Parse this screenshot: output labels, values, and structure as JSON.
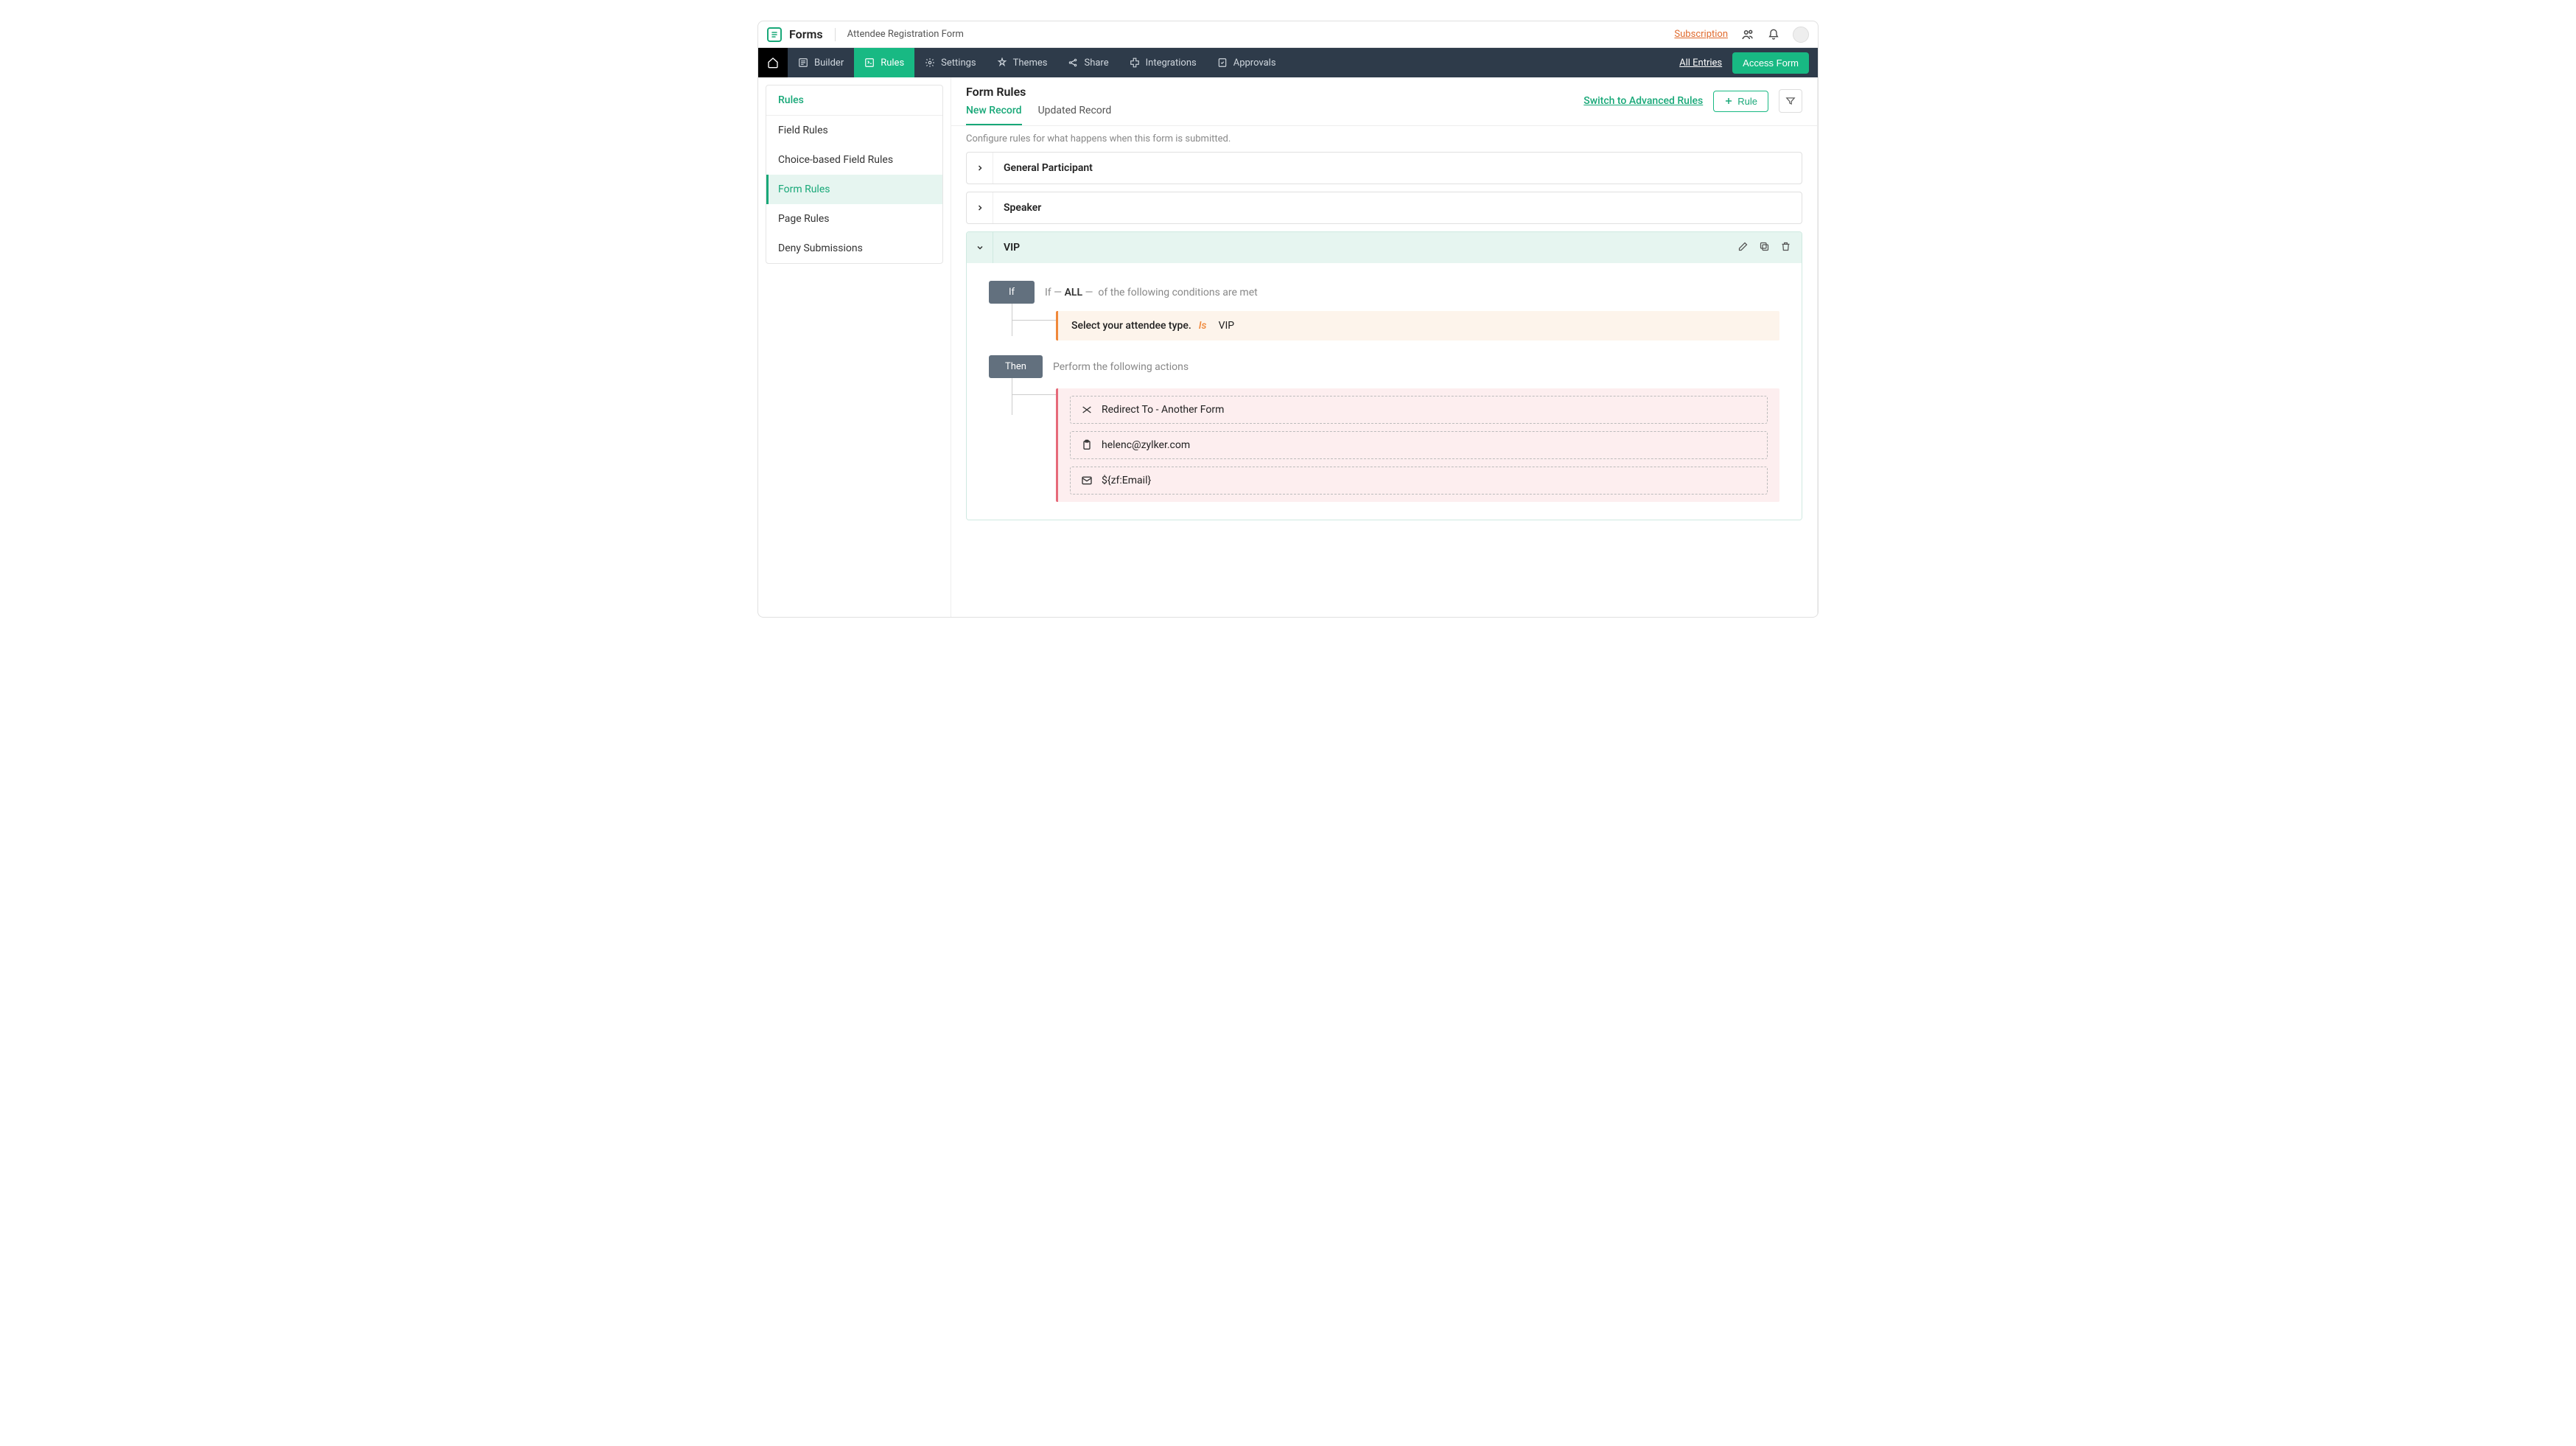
{
  "brand": "Forms",
  "form_name": "Attendee Registration Form",
  "topbar": {
    "subscription": "Subscription"
  },
  "nav": {
    "items": [
      "Builder",
      "Rules",
      "Settings",
      "Themes",
      "Share",
      "Integrations",
      "Approvals"
    ],
    "all_entries": "All Entries",
    "access_form": "Access Form"
  },
  "sidebar": {
    "heading": "Rules",
    "items": [
      "Field Rules",
      "Choice-based Field Rules",
      "Form Rules",
      "Page Rules",
      "Deny Submissions"
    ]
  },
  "content": {
    "title": "Form Rules",
    "tabs": [
      "New Record",
      "Updated Record"
    ],
    "adv_link": "Switch to Advanced Rules",
    "rule_btn": "Rule",
    "desc": "Configure rules for what happens when this form is submitted."
  },
  "rules": {
    "collapsed": [
      "General Participant",
      "Speaker"
    ],
    "expanded": {
      "title": "VIP",
      "if_label": "If",
      "if_prefix": "If",
      "if_quant": "ALL",
      "if_suffix": "of the following conditions are met",
      "condition": {
        "field": "Select your attendee type.",
        "op": "Is",
        "value": "VIP"
      },
      "then_label": "Then",
      "then_text": "Perform the following actions",
      "actions": [
        "Redirect To - Another Form",
        "helenc@zylker.com",
        "${zf:Email}"
      ]
    }
  }
}
